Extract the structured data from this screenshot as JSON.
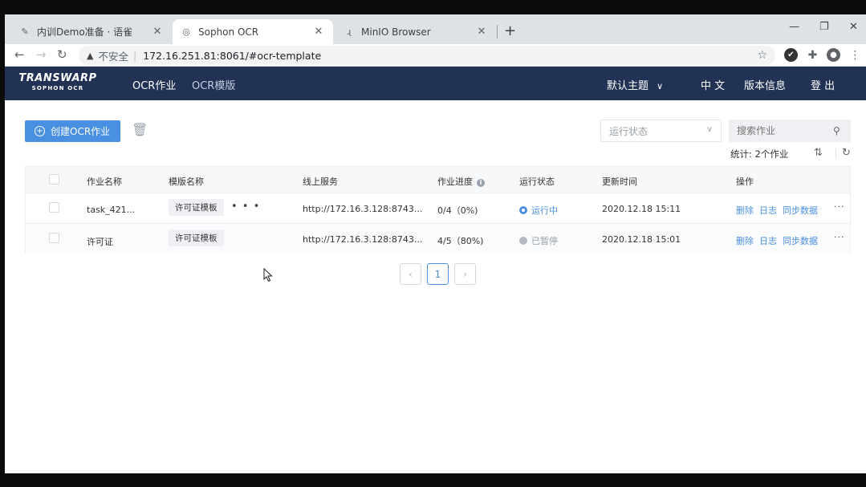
{
  "browser": {
    "tabs": [
      {
        "title": "内训Demo准备 · 语雀",
        "favicon": "yuque-icon",
        "close": "✕"
      },
      {
        "title": "Sophon OCR",
        "favicon": "sophon-icon",
        "close": "✕"
      },
      {
        "title": "MinIO Browser",
        "favicon": "minio-icon",
        "close": "✕"
      }
    ],
    "new_tab": "+",
    "address": {
      "insecure_label": "不安全",
      "url": "172.16.251.81:8061/#ocr-template"
    }
  },
  "header": {
    "logo_line1": "TRANSWARP",
    "logo_line2": "SOPHON OCR",
    "nav": [
      {
        "label": "OCR作业"
      },
      {
        "label": "OCR模版"
      }
    ],
    "theme": "默认主题",
    "language": "中 文",
    "version": "版本信息",
    "logout": "登 出"
  },
  "toolbar": {
    "create_label": "创建OCR作业",
    "status_placeholder": "运行状态",
    "search_placeholder": "搜索作业",
    "stats": "统计: 2个作业"
  },
  "table": {
    "headers": [
      "作业名称",
      "模版名称",
      "线上服务",
      "作业进度",
      "运行状态",
      "更新时间",
      "操作"
    ],
    "rows": [
      {
        "name": "task_421...",
        "template": "许可证模板",
        "service": "http://172.16.3.128:8743...",
        "progress": "0/4（0%)",
        "status": "运行中",
        "status_type": "running",
        "updated": "2020.12.18 15:11",
        "actions": [
          "删除",
          "日志",
          "同步数据"
        ],
        "more": "···"
      },
      {
        "name": "许可证",
        "template": "许可证模板",
        "service": "http://172.16.3.128:8743...",
        "progress": "4/5（80%)",
        "status": "已暂停",
        "status_type": "paused",
        "updated": "2020.12.18 15:01",
        "actions": [
          "删除",
          "日志",
          "同步数据"
        ],
        "more": "···"
      }
    ]
  },
  "pagination": {
    "prev": "‹",
    "current": "1",
    "next": "›"
  },
  "colors": {
    "header_bg": "#213254",
    "primary": "#4a90e2"
  }
}
